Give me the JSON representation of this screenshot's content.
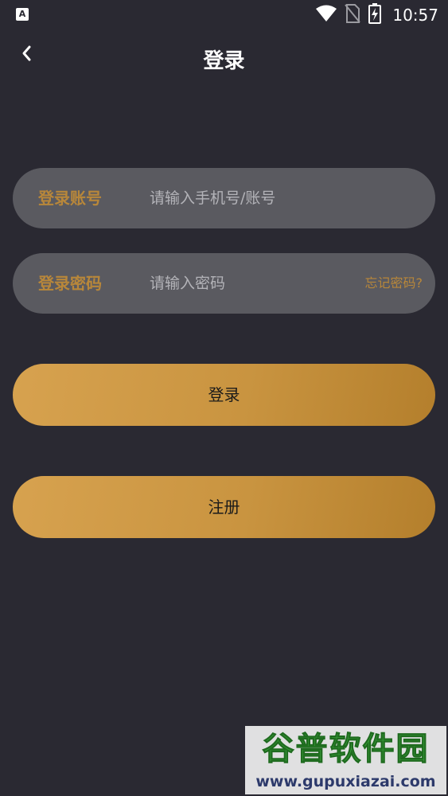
{
  "status_bar": {
    "app_icon_letter": "A",
    "time": "10:57",
    "icons": [
      "wifi-icon",
      "no-sim-icon",
      "battery-charging-icon"
    ]
  },
  "header": {
    "back_icon": "chevron-left-icon",
    "title": "登录"
  },
  "account_field": {
    "label": "登录账号",
    "placeholder": "请输入手机号/账号",
    "value": ""
  },
  "password_field": {
    "label": "登录密码",
    "placeholder": "请输入密码",
    "value": "",
    "forgot_label": "忘记密码?"
  },
  "login_button": {
    "label": "登录"
  },
  "register_button": {
    "label": "注册"
  },
  "watermark": {
    "brand": "谷普软件园",
    "url": "www.gupuxiazai.com"
  },
  "colors": {
    "background": "#2a2932",
    "accent_gold": "#b8873a",
    "button_gradient_start": "#d7a24f",
    "button_gradient_end": "#b47f2c",
    "input_background": "#5a5a60"
  }
}
